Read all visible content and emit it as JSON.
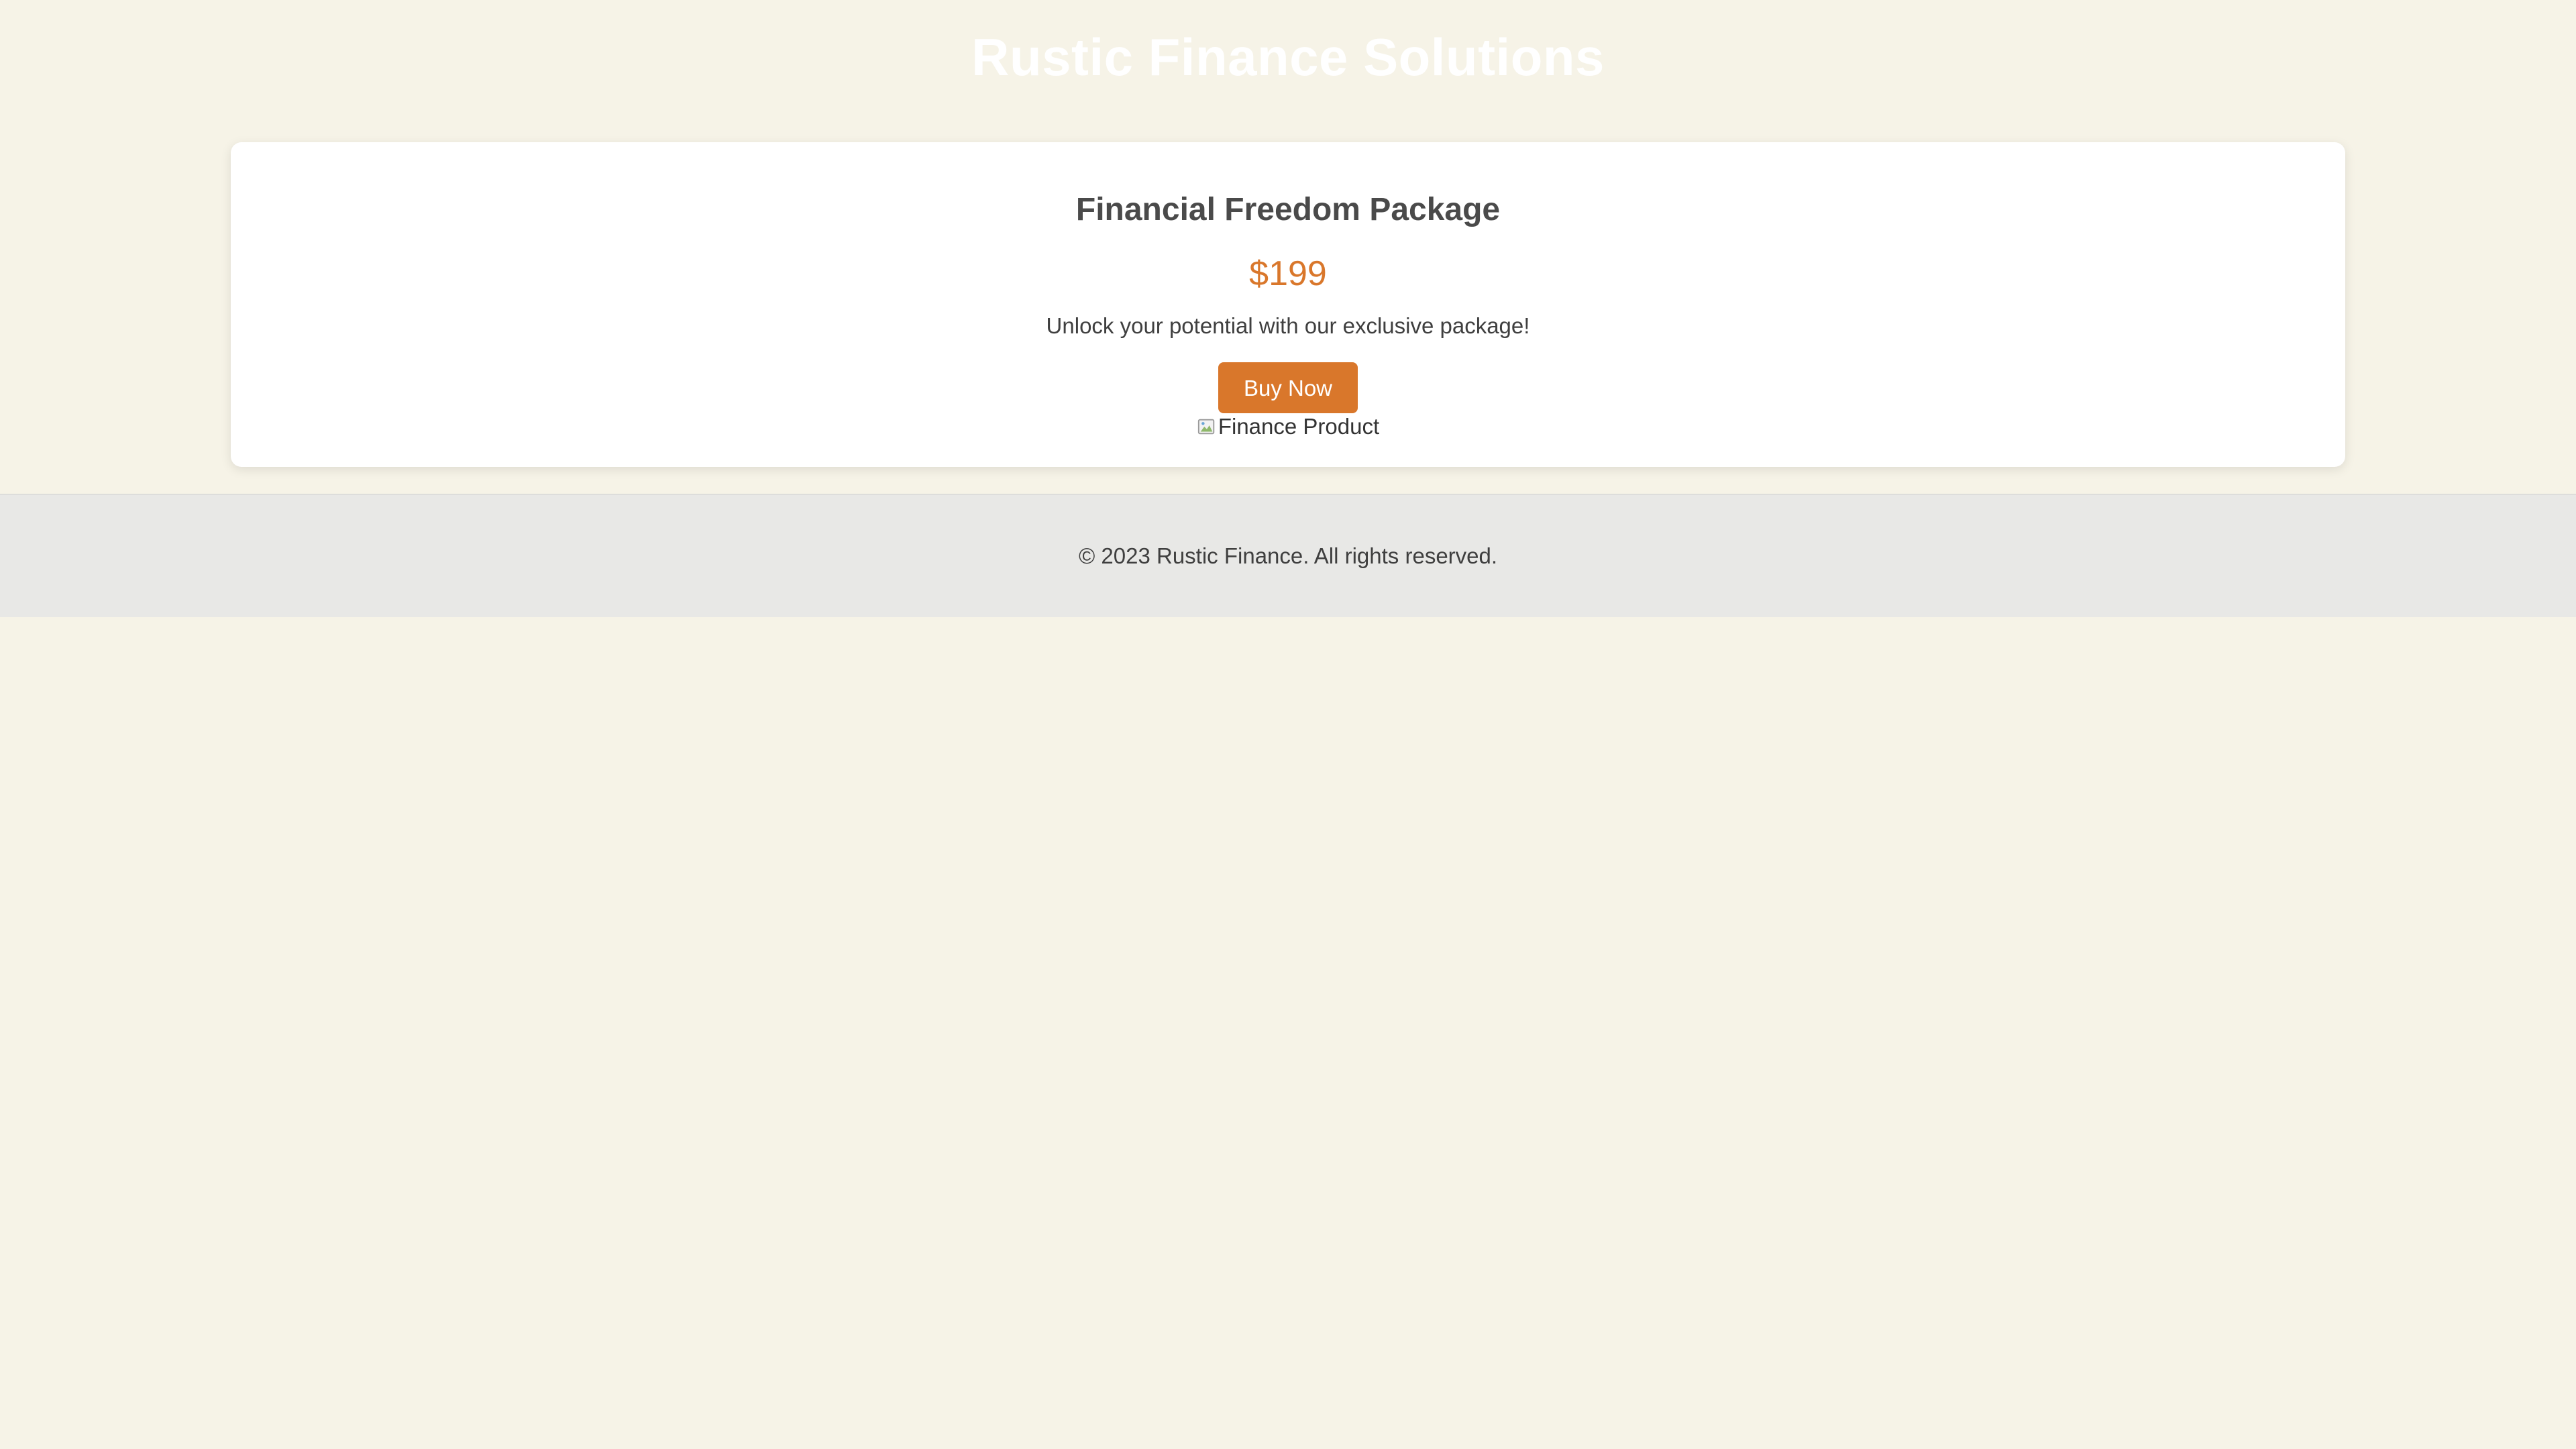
{
  "header": {
    "title": "Rustic Finance Solutions"
  },
  "product": {
    "title": "Financial Freedom Package",
    "price": "$199",
    "description": "Unlock your potential with our exclusive package!",
    "buy_label": "Buy Now",
    "image_alt": "Finance Product"
  },
  "footer": {
    "copyright": "© 2023 Rustic Finance. All rights reserved."
  },
  "colors": {
    "background": "#f6f3e7",
    "accent": "#d9772b",
    "card": "#ffffff",
    "footer": "#e8e8e6",
    "header_text": "#ffffff"
  },
  "icons": {
    "image": "broken-image-icon"
  }
}
